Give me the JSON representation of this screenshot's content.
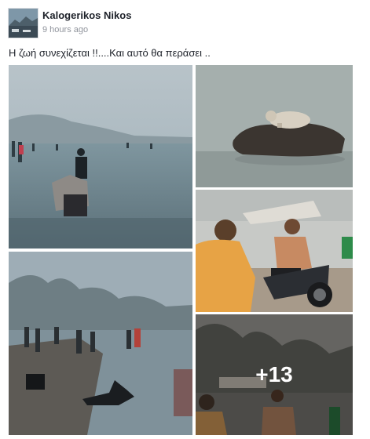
{
  "post": {
    "author": "Kalogerikos Nikos",
    "timestamp": "9 hours ago",
    "text": "Η ζωή συνεχίζεται !!....Και αυτό θα περάσει .."
  },
  "photos": [
    {
      "icon": "photo-beach-people-in-water"
    },
    {
      "icon": "photo-dog-on-rock"
    },
    {
      "icon": "photo-men-on-motorbike"
    },
    {
      "icon": "photo-shore-smoke-crowd"
    },
    {
      "icon": "photo-smoky-crowd-more"
    }
  ],
  "more_photos": {
    "label": "+13"
  },
  "colors": {
    "author": "#1d2129",
    "timestamp": "#90949c",
    "overlay_text": "#ffffff"
  }
}
